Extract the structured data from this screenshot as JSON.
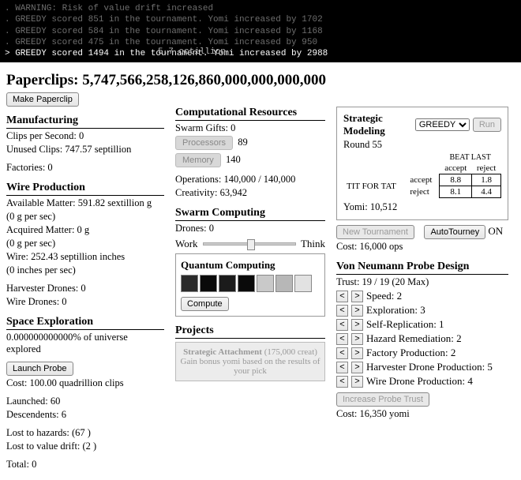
{
  "console": {
    "lines": [
      ". WARNING: Risk of value drift increased",
      ". GREEDY scored 851 in the tournament. Yomi increased by 1702",
      ". GREEDY scored 584 in the tournament. Yomi increased by 1168",
      ". GREEDY scored 475 in the tournament. Yomi increased by 950"
    ],
    "last": "> GREEDY scored 1494 in the tournament. Yomi increased by 2988",
    "ghost": "5.7 octillion"
  },
  "title_label": "Paperclips:",
  "title_value": "5,747,566,258,126,860,000,000,000,000",
  "make_paperclip": "Make Paperclip",
  "manufacturing": {
    "title": "Manufacturing",
    "cps": "Clips per Second: 0",
    "unused": "Unused Clips: 747.57 septillion",
    "factories": "Factories: 0"
  },
  "wire": {
    "title": "Wire Production",
    "avail": "Available Matter: 591.82 sextillion g",
    "avail_rate": "(0 g per sec)",
    "acq": "Acquired Matter: 0 g",
    "acq_rate": "(0 g per sec)",
    "wire": "Wire: 252.43 septillion inches",
    "wire_rate": "(0 inches per sec)",
    "harv": "Harvester Drones: 0",
    "wired": "Wire Drones: 0"
  },
  "space": {
    "title": "Space Exploration",
    "explored": "0.000000000000% of universe explored",
    "launch": "Launch Probe",
    "cost": "Cost: 100.00 quadrillion clips",
    "launched": "Launched: 60",
    "desc": "Descendents: 6",
    "haz": "Lost to hazards: (67 )",
    "drift": "Lost to value drift: (2 )",
    "total": "Total: 0"
  },
  "comp": {
    "title": "Computational Resources",
    "swarm": "Swarm Gifts: 0",
    "proc_label": "Processors",
    "proc_val": "89",
    "mem_label": "Memory",
    "mem_val": "140",
    "ops": "Operations: 140,000 / 140,000",
    "creat": "Creativity: 63,942"
  },
  "swarm": {
    "title": "Swarm Computing",
    "drones": "Drones: 0",
    "work": "Work",
    "think": "Think"
  },
  "quantum": {
    "title": "Quantum Computing",
    "compute": "Compute"
  },
  "projects": {
    "title": "Projects",
    "name": "Strategic Attachment",
    "cost": "(175,000 creat)",
    "desc": "Gain bonus yomi based on the results of your pick"
  },
  "strat": {
    "title": "Strategic Modeling",
    "selected": "GREEDY",
    "run": "Run",
    "round": "Round 55",
    "beat": "BEAT LAST",
    "accept": "accept",
    "reject": "reject",
    "rowlabel": "TIT FOR TAT",
    "cells": [
      "8.8",
      "1.8",
      "8.1",
      "4.4"
    ],
    "yomi": "Yomi: 10,512",
    "newt": "New Tournament",
    "auto": "AutoTourney",
    "on": "ON",
    "cost": "Cost: 16,000 ops"
  },
  "vnp": {
    "title": "Von Neumann Probe Design",
    "trust": "Trust: 19 / 19 (20 Max)",
    "rows": [
      {
        "label": "Speed: 2"
      },
      {
        "label": "Exploration: 3"
      },
      {
        "label": "Self-Replication: 1"
      },
      {
        "label": "Hazard Remediation: 2"
      },
      {
        "label": "Factory Production: 2"
      },
      {
        "label": "Harvester Drone Production: 5"
      },
      {
        "label": "Wire Drone Production: 4"
      }
    ],
    "inc": "Increase Probe Trust",
    "cost": "Cost: 16,350 yomi"
  },
  "chip_colors": [
    "#2a2a2a",
    "#0a0a0a",
    "#1b1b1b",
    "#0a0a0a",
    "#c9c9c9",
    "#b7b7b7",
    "#e2e2e2"
  ]
}
